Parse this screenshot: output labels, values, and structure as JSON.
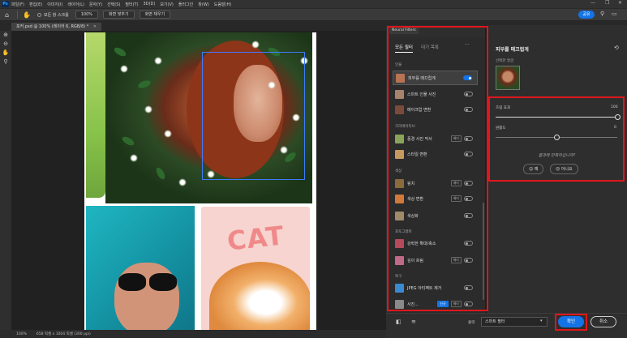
{
  "menubar": {
    "app_icon": "Ps",
    "items": [
      "파일(F)",
      "편집(E)",
      "이미지(I)",
      "레이어(L)",
      "문자(Y)",
      "선택(S)",
      "필터(T)",
      "3D(D)",
      "보기(V)",
      "플러그인",
      "창(W)",
      "도움말(H)"
    ],
    "window_controls": [
      "—",
      "❐",
      "✕"
    ]
  },
  "options_bar": {
    "home_icon": "home-icon",
    "scroll_all_label": "모든 창 스크롤",
    "zoom_value": "100%",
    "fit_screen_label": "화면 맞추기",
    "fill_screen_label": "화면 채우기",
    "share_label": "공유"
  },
  "doc_tab": {
    "title": "포커.psd @ 100% (레이어 6, RGB/8) *"
  },
  "status_bar": {
    "zoom": "100%",
    "doc_size": "658 픽셀 x 1004 픽셀 (300 ppi)"
  },
  "neural_filters": {
    "panel_title": "Neural Filters",
    "tabs": [
      "모든 필터",
      "대기 목록"
    ],
    "more": "···",
    "categories": [
      {
        "label": "인물",
        "items": [
          {
            "name": "피부를 매끄럽게",
            "badge": "",
            "on": true,
            "thumb": "#b87355"
          },
          {
            "name": "스마트 인물 사진",
            "badge": "",
            "on": false,
            "thumb": "#a9826b"
          },
          {
            "name": "메이크업 변환",
            "badge": "",
            "on": false,
            "thumb": "#7a4a3a"
          }
        ]
      },
      {
        "label": "크리에이티브",
        "items": [
          {
            "name": "풍경 사진 믹서",
            "badge": "베타",
            "on": false,
            "thumb": "#8aa35a"
          },
          {
            "name": "스타일 변환",
            "badge": "",
            "on": false,
            "thumb": "#c69a5e"
          }
        ]
      },
      {
        "label": "색상",
        "items": [
          {
            "name": "윙치",
            "badge": "베타",
            "on": false,
            "thumb": "#8c6a3e"
          },
          {
            "name": "색상 변환",
            "badge": "베타",
            "on": false,
            "thumb": "#d07a3a"
          },
          {
            "name": "색상화",
            "badge": "",
            "on": false,
            "thumb": "#a08a6a"
          }
        ]
      },
      {
        "label": "포토그래피",
        "items": [
          {
            "name": "강력한 확대/축소",
            "badge": "",
            "on": false,
            "thumb": "#b44a5a"
          },
          {
            "name": "깊이 흐림",
            "badge": "베타",
            "on": false,
            "thumb": "#c06a8a"
          }
        ]
      },
      {
        "label": "복구",
        "items": [
          {
            "name": "JPEG 아티팩트 제거",
            "badge": "",
            "on": false,
            "thumb": "#3a8ad0"
          },
          {
            "name": "사진...",
            "badge": "베타",
            "badge_new": "신규",
            "on": false,
            "thumb": "#8a8a8a"
          }
        ]
      }
    ]
  },
  "settings": {
    "title": "피부를 매끄럽게",
    "selected_face_label": "선택한 얼굴",
    "sliders": [
      {
        "label": "흐림 효과",
        "value": 100,
        "max": 100,
        "value_text": "100"
      },
      {
        "label": "원활도",
        "value": 0,
        "min": -50,
        "max": 50,
        "value_text": "0"
      }
    ],
    "feedback_question": "결과에 만족하십니까?",
    "yes_label": "예",
    "no_label": "아니요"
  },
  "bottom_bar": {
    "output_label": "출력",
    "output_value": "스마트 필터",
    "ok_label": "확인",
    "cancel_label": "취소"
  },
  "colors": {
    "accent": "#1473e6",
    "highlight": "#e0161b",
    "panel_bg": "#2e2e2e"
  }
}
